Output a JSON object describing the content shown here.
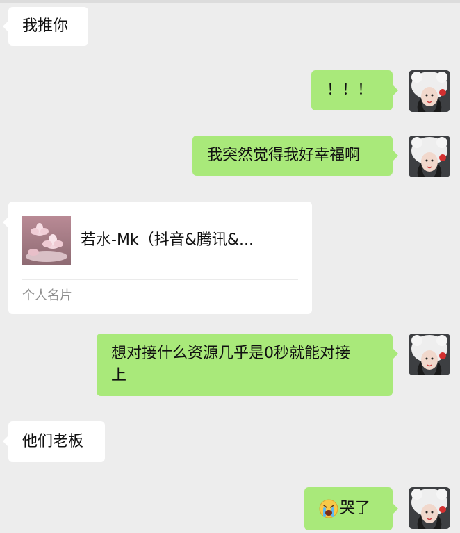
{
  "messages": [
    {
      "side": "left",
      "text": "我推你"
    },
    {
      "side": "right",
      "text": "！！！"
    },
    {
      "side": "right",
      "text": "我突然觉得我好幸福啊"
    },
    {
      "side": "left",
      "type": "card",
      "name": "若水-Mk（抖音&腾讯&...",
      "card_type": "个人名片"
    },
    {
      "side": "right",
      "text": "想对接什么资源几乎是0秒就能对接\n上"
    },
    {
      "side": "left",
      "text": "他们老板"
    },
    {
      "side": "right",
      "emoji": "crying-face-emoji",
      "text": "哭了"
    }
  ],
  "colors": {
    "background": "#ededed",
    "left_bubble": "#ffffff",
    "right_bubble": "#a9e97a",
    "secondary_text": "#8f8f8f"
  },
  "icons": {
    "user_avatar": "user-avatar-girl-in-white-hat",
    "card_avatar": "lotus-flower-thumbnail",
    "emoji": "crying-face-emoji"
  }
}
